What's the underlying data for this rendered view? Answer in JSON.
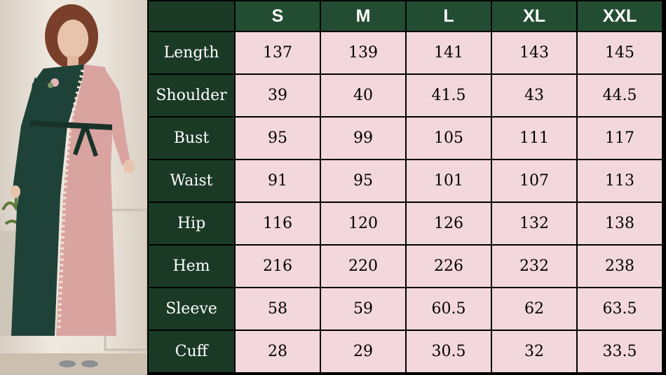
{
  "colors": {
    "header_bg": "#234d33",
    "label_bg": "#1b3a26",
    "cell_bg": "#f2d7dc",
    "grid": "#000000",
    "dress_green": "#1e4238",
    "dress_pink": "#d9a3a0"
  },
  "product_photo": {
    "icon": "dress-model-photo"
  },
  "table": {
    "headers": [
      "S",
      "M",
      "L",
      "XL",
      "XXL"
    ],
    "rows": [
      {
        "label": "Length",
        "values": [
          "137",
          "139",
          "141",
          "143",
          "145"
        ]
      },
      {
        "label": "Shoulder",
        "values": [
          "39",
          "40",
          "41.5",
          "43",
          "44.5"
        ]
      },
      {
        "label": "Bust",
        "values": [
          "95",
          "99",
          "105",
          "111",
          "117"
        ]
      },
      {
        "label": "Waist",
        "values": [
          "91",
          "95",
          "101",
          "107",
          "113"
        ]
      },
      {
        "label": "Hip",
        "values": [
          "116",
          "120",
          "126",
          "132",
          "138"
        ]
      },
      {
        "label": "Hem",
        "values": [
          "216",
          "220",
          "226",
          "232",
          "238"
        ]
      },
      {
        "label": "Sleeve",
        "values": [
          "58",
          "59",
          "60.5",
          "62",
          "63.5"
        ]
      },
      {
        "label": "Cuff",
        "values": [
          "28",
          "29",
          "30.5",
          "32",
          "33.5"
        ]
      }
    ]
  }
}
